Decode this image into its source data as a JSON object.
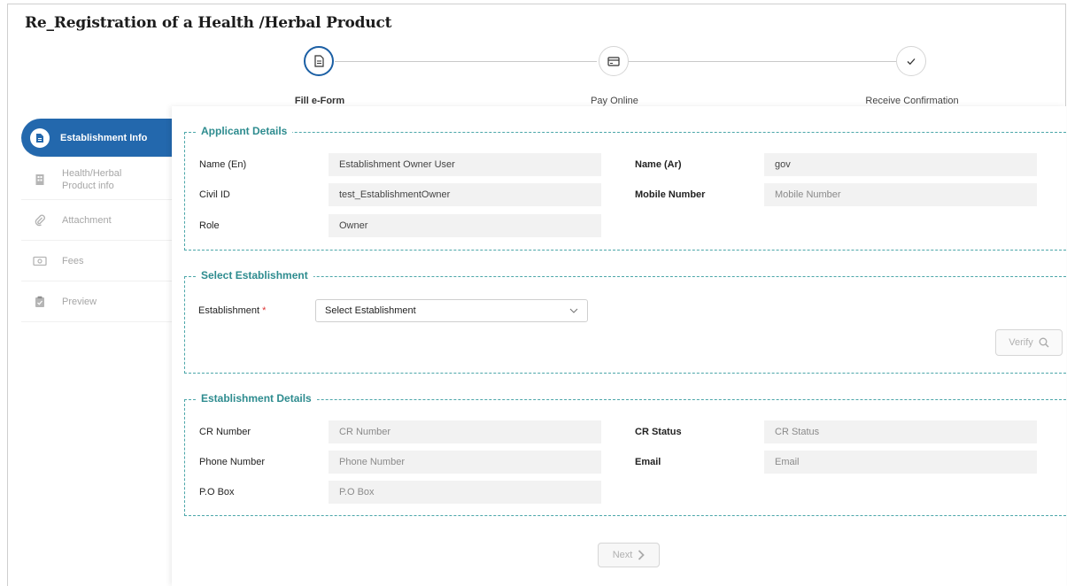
{
  "page": {
    "title": "Re_Registration of a Health /Herbal Product"
  },
  "stepper": {
    "steps": [
      {
        "label": "Fill e-Form",
        "icon": "document-icon",
        "active": true
      },
      {
        "label": "Pay Online",
        "icon": "card-icon",
        "active": false
      },
      {
        "label": "Receive Confirmation",
        "icon": "check-icon",
        "active": false
      }
    ]
  },
  "sidebar": {
    "items": [
      {
        "label": "Establishment Info",
        "icon": "document-icon",
        "active": true
      },
      {
        "label": "Health/Herbal Product info",
        "icon": "building-icon",
        "active": false
      },
      {
        "label": "Attachment",
        "icon": "paperclip-icon",
        "active": false
      },
      {
        "label": "Fees",
        "icon": "money-icon",
        "active": false
      },
      {
        "label": "Preview",
        "icon": "clipboard-icon",
        "active": false
      }
    ]
  },
  "applicant": {
    "legend": "Applicant Details",
    "name_en_label": "Name (En)",
    "name_en_value": "Establishment Owner User",
    "name_ar_label": "Name (Ar)",
    "name_ar_value": "gov",
    "civil_id_label": "Civil ID",
    "civil_id_value": "test_EstablishmentOwner",
    "mobile_label": "Mobile Number",
    "mobile_placeholder": "Mobile Number",
    "role_label": "Role",
    "role_value": "Owner"
  },
  "select_establishment": {
    "legend": "Select Establishment",
    "label": "Establishment",
    "required_mark": "*",
    "selected": "Select Establishment",
    "verify_label": "Verify"
  },
  "establishment_details": {
    "legend": "Establishment Details",
    "cr_number_label": "CR Number",
    "cr_number_placeholder": "CR Number",
    "cr_status_label": "CR Status",
    "cr_status_placeholder": "CR Status",
    "phone_label": "Phone Number",
    "phone_placeholder": "Phone Number",
    "email_label": "Email",
    "email_placeholder": "Email",
    "pobox_label": "P.O Box",
    "pobox_placeholder": "P.O Box"
  },
  "footer": {
    "next_label": "Next"
  },
  "colors": {
    "primary": "#2368ad",
    "section": "#2e8c8f",
    "required": "#dd3333"
  }
}
